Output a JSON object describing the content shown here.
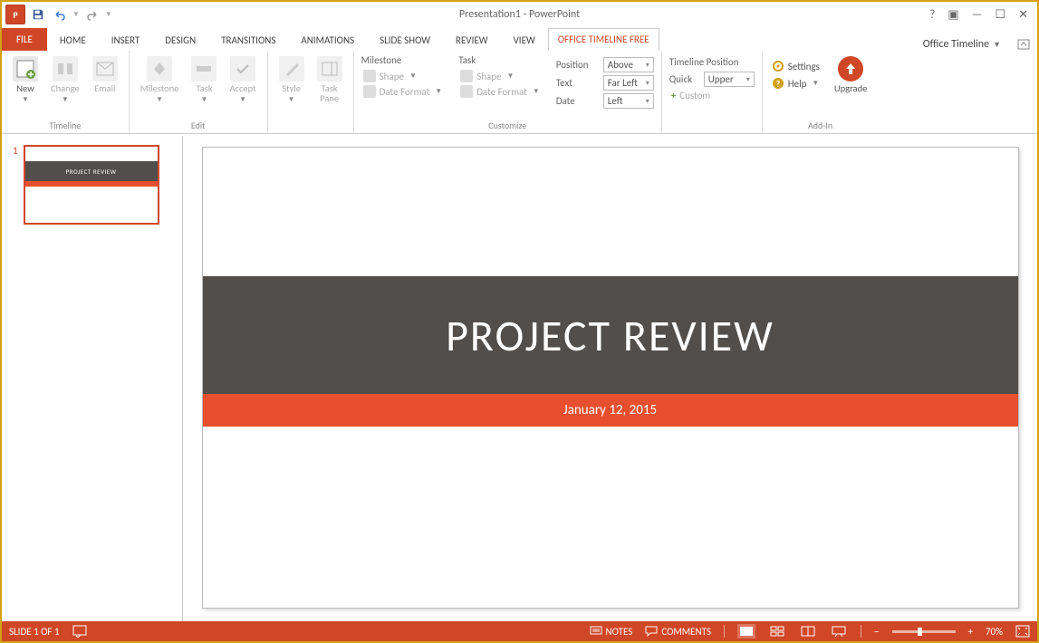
{
  "titlebar": {
    "app_icon_text": "P",
    "title": "Presentation1 - PowerPoint"
  },
  "tabs": {
    "file": "FILE",
    "items": [
      "HOME",
      "INSERT",
      "DESIGN",
      "TRANSITIONS",
      "ANIMATIONS",
      "SLIDE SHOW",
      "REVIEW",
      "VIEW"
    ],
    "active": "OFFICE TIMELINE FREE",
    "right": "Office Timeline"
  },
  "ribbon": {
    "timeline": {
      "new": "New",
      "change": "Change",
      "email": "Email",
      "label": "Timeline"
    },
    "edit": {
      "milestone": "Milestone",
      "task": "Task",
      "accept": "Accept",
      "label": "Edit"
    },
    "style_btn": "Style",
    "taskpane_btn": "Task\nPane",
    "customize": {
      "milestone_hdr": "Milestone",
      "task_hdr": "Task",
      "shape": "Shape",
      "date_format": "Date Format",
      "position_lbl": "Position",
      "position_val": "Above",
      "text_lbl": "Text",
      "text_val": "Far Left",
      "date_lbl": "Date",
      "date_val": "Left",
      "label": "Customize"
    },
    "timeline_pos": {
      "header": "Timeline Position",
      "quick_lbl": "Quick",
      "quick_val": "Upper",
      "custom": "Custom"
    },
    "addin": {
      "settings": "Settings",
      "help": "Help",
      "upgrade": "Upgrade",
      "label": "Add-In"
    }
  },
  "thumb": {
    "num": "1",
    "title": "PROJECT REVIEW"
  },
  "slide": {
    "title": "PROJECT REVIEW",
    "date": "January 12, 2015"
  },
  "status": {
    "slide": "SLIDE 1 OF 1",
    "notes": "NOTES",
    "comments": "COMMENTS",
    "zoom": "70%"
  }
}
